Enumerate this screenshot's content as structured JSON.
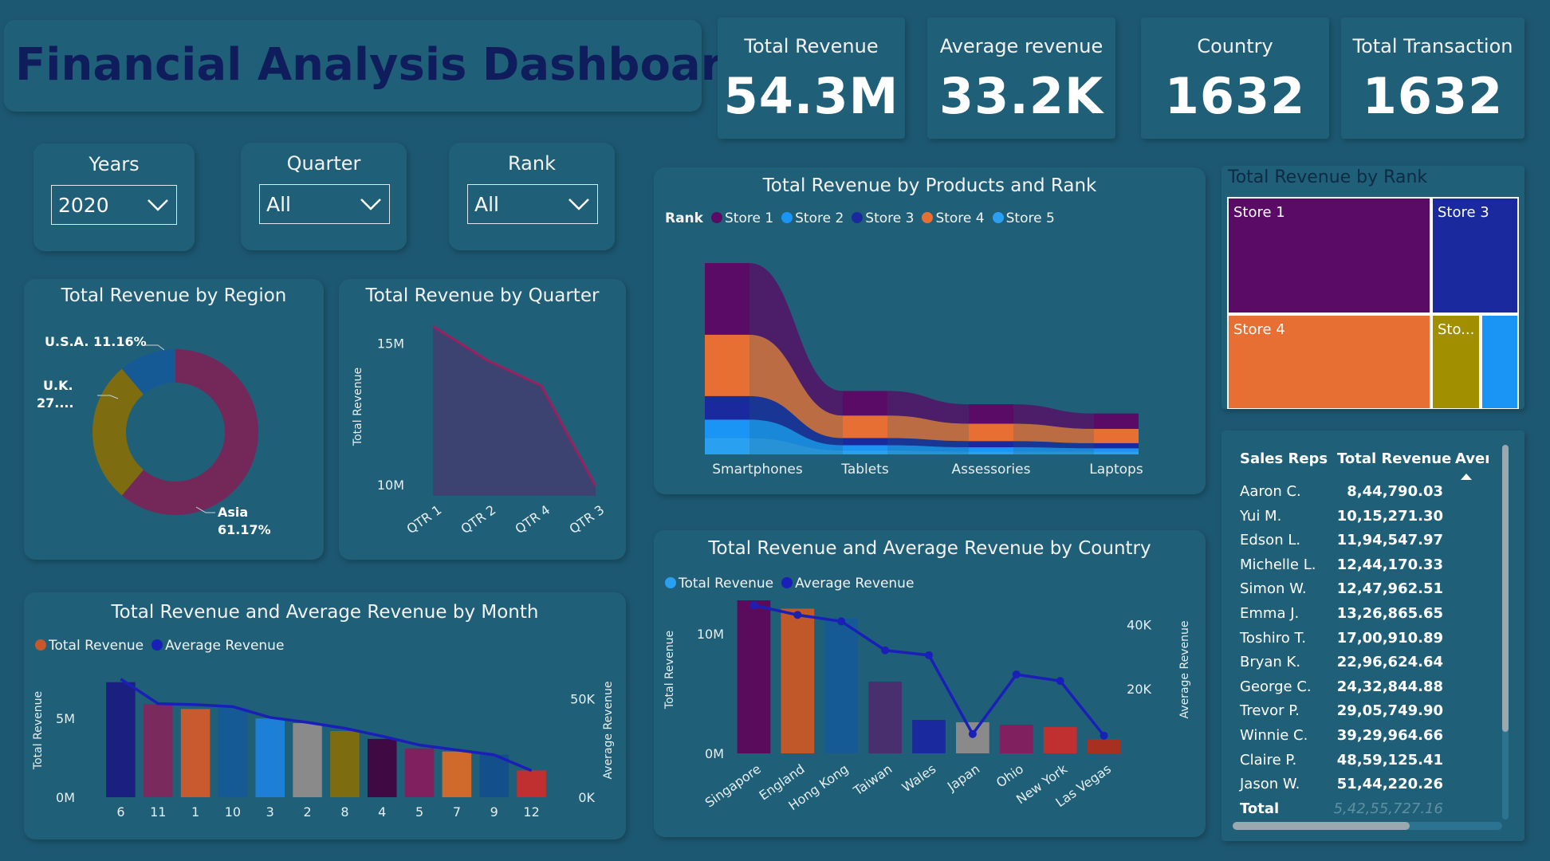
{
  "dashboard_title": "Financial Analysis Dashboard",
  "kpis": [
    {
      "label": "Total Revenue",
      "value": "54.3M"
    },
    {
      "label": "Average revenue",
      "value": "33.2K"
    },
    {
      "label": "Country",
      "value": "1632"
    },
    {
      "label": "Total Transaction",
      "value": "1632"
    }
  ],
  "slicers": [
    {
      "title": "Years",
      "value": "2020"
    },
    {
      "title": "Quarter",
      "value": "All"
    },
    {
      "title": "Rank",
      "value": "All"
    }
  ],
  "colors": {
    "background": "#1d5872",
    "card": "#1f6078",
    "title_text": "#0f1d5c",
    "line_avg": "#1a1fb8",
    "store1": "#5a0b66",
    "store2": "#1a94f5",
    "store3": "#1a2a9e",
    "store4": "#e86f33",
    "store5": "#2aa0f0"
  },
  "chart_data": [
    {
      "id": "region",
      "type": "pie",
      "title": "Total Revenue by Region",
      "labels": [
        "Asia",
        "U.K.",
        "U.S.A."
      ],
      "values": [
        61.17,
        27.67,
        11.16
      ],
      "display_labels": [
        "Asia\n61.17%",
        "U.K.\n27....",
        "U.S.A. 11.16%"
      ],
      "colors": [
        "#74285a",
        "#7d6c10",
        "#155a94"
      ]
    },
    {
      "id": "quarter",
      "type": "area",
      "title": "Total Revenue by Quarter",
      "ylabel": "Total Revenue",
      "categories": [
        "QTR 1",
        "QTR 2",
        "QTR 4",
        "QTR 3"
      ],
      "values": [
        15.6,
        14.4,
        13.5,
        9.95
      ],
      "ytick_labels": [
        "10M",
        "15M"
      ],
      "yticks": [
        10,
        15
      ],
      "ylim": [
        9.6,
        16.2
      ]
    },
    {
      "id": "products",
      "type": "area",
      "title": "Total Revenue by Products and Rank",
      "legend_title": "Rank",
      "categories": [
        "Smartphones",
        "Tablets",
        "Assessories",
        "Laptops"
      ],
      "series": [
        {
          "name": "Store 1",
          "values": [
            7.0,
            2.4,
            1.9,
            1.5
          ],
          "color": "#5a0b66"
        },
        {
          "name": "Store 2",
          "values": [
            1.8,
            0.5,
            0.4,
            0.3
          ],
          "color": "#1a94f5"
        },
        {
          "name": "Store 3",
          "values": [
            2.3,
            0.7,
            0.6,
            0.5
          ],
          "color": "#1a2a9e"
        },
        {
          "name": "Store 4",
          "values": [
            6.0,
            2.2,
            1.7,
            1.4
          ],
          "color": "#e86f33"
        },
        {
          "name": "Store 5",
          "values": [
            1.6,
            0.4,
            0.3,
            0.3
          ],
          "color": "#2aa0f0"
        }
      ]
    },
    {
      "id": "rank_treemap",
      "type": "treemap",
      "title": "Total Revenue by Rank",
      "labels": [
        "Store 1",
        "Store 3",
        "Store 4",
        "Sto...",
        ""
      ],
      "values": [
        37.0,
        14.0,
        28.0,
        10.0,
        11.0
      ],
      "colors": [
        "#5a0b66",
        "#1a2a9e",
        "#e86f33",
        "#a28f00",
        "#1a94f5"
      ]
    },
    {
      "id": "month",
      "type": "bar",
      "title": "Total Revenue and Average Revenue by Month",
      "ylabel": "Total Revenue",
      "y2label": "Average Revenue",
      "categories": [
        "6",
        "11",
        "1",
        "10",
        "3",
        "2",
        "8",
        "4",
        "5",
        "7",
        "9",
        "12"
      ],
      "series": [
        {
          "name": "Total Revenue",
          "values": [
            7.3,
            5.9,
            5.6,
            5.7,
            5.0,
            4.7,
            4.2,
            3.7,
            3.1,
            2.9,
            2.7,
            1.7
          ]
        },
        {
          "name": "Average Revenue",
          "values": [
            60.0,
            47.5,
            47.0,
            46.0,
            40.5,
            38.0,
            35.0,
            31.0,
            26.5,
            24.0,
            21.5,
            13.5
          ]
        }
      ],
      "bar_colors": [
        "#1a1f80",
        "#7a2a5c",
        "#c85a30",
        "#155a94",
        "#1e7fd6",
        "#8a8a8a",
        "#7d6c10",
        "#3f0a44",
        "#80205e",
        "#d06a2c",
        "#134f8a",
        "#c03030"
      ],
      "ytick_labels": [
        "0M",
        "5M"
      ],
      "yticks": [
        0,
        5
      ],
      "y2tick_labels": [
        "0K",
        "50K"
      ],
      "y2ticks": [
        0,
        50
      ],
      "ylim": [
        0,
        8.5
      ],
      "y2lim": [
        0,
        68
      ]
    },
    {
      "id": "country",
      "type": "bar",
      "title": "Total Revenue and Average Revenue by Country",
      "ylabel": "Total Revenue",
      "y2label": "Average Revenue",
      "categories": [
        "Singapore",
        "England",
        "Hong Kong",
        "Taiwan",
        "Wales",
        "Japan",
        "Ohio",
        "New York",
        "Las Vegas"
      ],
      "series": [
        {
          "name": "Total Revenue",
          "values": [
            12.8,
            12.1,
            11.3,
            6.0,
            2.8,
            2.6,
            2.4,
            2.2,
            1.2
          ]
        },
        {
          "name": "Average Revenue",
          "values": [
            46.0,
            43.0,
            41.0,
            32.0,
            30.5,
            6.0,
            24.5,
            22.5,
            5.5
          ]
        }
      ],
      "bar_colors": [
        "#5a0b5c",
        "#c0582a",
        "#155a94",
        "#4a2f6e",
        "#1a2a9e",
        "#8a8a8a",
        "#80205e",
        "#c03030",
        "#a83020"
      ],
      "ytick_labels": [
        "0M",
        "10M"
      ],
      "yticks": [
        0,
        10
      ],
      "y2tick_labels": [
        "20K",
        "40K"
      ],
      "y2ticks": [
        20,
        40
      ],
      "ylim": [
        0,
        14
      ],
      "y2lim": [
        0,
        52
      ]
    },
    {
      "id": "sales_reps",
      "type": "table",
      "columns": [
        "Sales Reps",
        "Total Revenue",
        "Averag"
      ],
      "rows": [
        [
          "Aaron C.",
          "8,44,790.03"
        ],
        [
          "Yui M.",
          "10,15,271.30"
        ],
        [
          "Edson L.",
          "11,94,547.97"
        ],
        [
          "Michelle L.",
          "12,44,170.33"
        ],
        [
          "Simon W.",
          "12,47,962.51"
        ],
        [
          "Emma J.",
          "13,26,865.65"
        ],
        [
          "Toshiro T.",
          "17,00,910.89"
        ],
        [
          "Bryan K.",
          "22,96,624.64"
        ],
        [
          "George C.",
          "24,32,844.88"
        ],
        [
          "Trevor P.",
          "29,05,749.90"
        ],
        [
          "Winnie C.",
          "39,29,964.66"
        ],
        [
          "Claire P.",
          "48,59,125.41"
        ],
        [
          "Jason W.",
          "51,44,220.26"
        ]
      ],
      "total_label": "Total",
      "total_value": "5,42,55,727.16"
    }
  ]
}
